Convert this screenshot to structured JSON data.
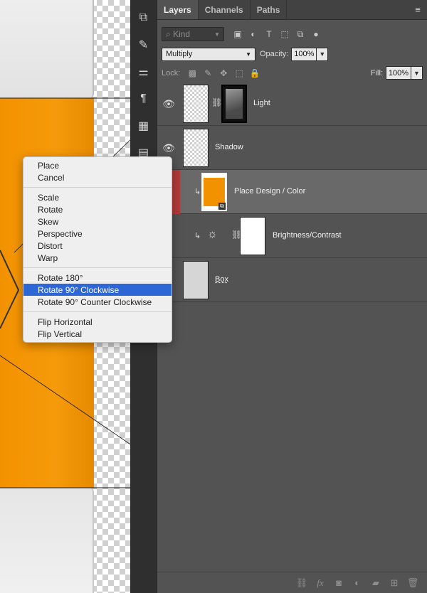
{
  "panel": {
    "tabs": [
      "Layers",
      "Channels",
      "Paths"
    ],
    "active_tab": "Layers",
    "filter": {
      "placeholder": "Kind"
    },
    "blend_mode": "Multiply",
    "opacity_label": "Opacity:",
    "opacity_value": "100%",
    "lock_label": "Lock:",
    "fill_label": "Fill:",
    "fill_value": "100%"
  },
  "layers": [
    {
      "name": "Light",
      "visible": true,
      "has_mask": true
    },
    {
      "name": "Shadow",
      "visible": true
    },
    {
      "name": "Place Design / Color",
      "selected": true,
      "clipped": true,
      "smart_object": true
    },
    {
      "name": "Brightness/Contrast",
      "clipped": true,
      "adjustment": "brightness-contrast"
    },
    {
      "name": "Box"
    }
  ],
  "context_menu": {
    "groups": [
      [
        "Place",
        "Cancel"
      ],
      [
        "Scale",
        "Rotate",
        "Skew",
        "Perspective",
        "Distort",
        "Warp"
      ],
      [
        "Rotate 180°",
        "Rotate 90° Clockwise",
        "Rotate 90° Counter Clockwise"
      ],
      [
        "Flip Horizontal",
        "Flip Vertical"
      ]
    ],
    "highlighted": "Rotate 90° Clockwise"
  },
  "colors": {
    "panel_bg": "#535353",
    "selected_layer": "#696969",
    "menu_highlight": "#2d67d6",
    "box_orange": "#f39200",
    "eye_strip": "#b43a3a"
  },
  "icons": {
    "tool_strip": [
      "align-icon",
      "brush-presets-icon",
      "adjustments-icon",
      "paragraph-icon",
      "layout-icon",
      "notes-icon"
    ],
    "bottom_bar": [
      "link-icon",
      "fx-icon",
      "mask-icon",
      "adjustment-layer-icon",
      "group-folder-icon",
      "new-layer-icon",
      "trash-icon"
    ]
  }
}
